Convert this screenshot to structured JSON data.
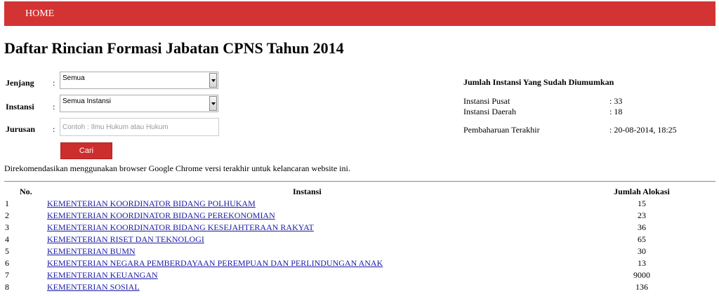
{
  "nav": {
    "home": "HOME"
  },
  "page": {
    "title": "Daftar Rincian Formasi Jabatan CPNS Tahun 2014"
  },
  "form": {
    "jenjang_label": "Jenjang",
    "jenjang_value": "Semua",
    "instansi_label": "Instansi",
    "instansi_value": "Semua Instansi",
    "jurusan_label": "Jurusan",
    "jurusan_placeholder": "Contoh : Ilmu Hukum atau Hukum",
    "colon": ":",
    "search_button": "Cari"
  },
  "recommendation": "Direkomendasikan menggunakan browser Google Chrome versi terakhir untuk kelancaran website ini.",
  "info": {
    "title": "Jumlah Instansi Yang Sudah Diumumkan",
    "pusat_label": "Instansi Pusat",
    "pusat_value": ": 33",
    "daerah_label": "Instansi Daerah",
    "daerah_value": ": 18",
    "updated_label": "Pembaharuan Terakhir",
    "updated_value": ": 20-08-2014, 18:25"
  },
  "table": {
    "headers": {
      "no": "No.",
      "instansi": "Instansi",
      "jumlah": "Jumlah Alokasi"
    },
    "rows": [
      {
        "no": "1",
        "instansi": "KEMENTERIAN KOORDINATOR BIDANG POLHUKAM",
        "jumlah": "15"
      },
      {
        "no": "2",
        "instansi": "KEMENTERIAN KOORDINATOR BIDANG PEREKONOMIAN",
        "jumlah": "23"
      },
      {
        "no": "3",
        "instansi": "KEMENTERIAN KOORDINATOR BIDANG KESEJAHTERAAN RAKYAT",
        "jumlah": "36"
      },
      {
        "no": "4",
        "instansi": "KEMENTERIAN RISET DAN TEKNOLOGI",
        "jumlah": "65"
      },
      {
        "no": "5",
        "instansi": "KEMENTERIAN BUMN",
        "jumlah": "30"
      },
      {
        "no": "6",
        "instansi": "KEMENTERIAN NEGARA PEMBERDAYAAN PEREMPUAN DAN PERLINDUNGAN ANAK",
        "jumlah": "13"
      },
      {
        "no": "7",
        "instansi": "KEMENTERIAN KEUANGAN",
        "jumlah": "9000"
      },
      {
        "no": "8",
        "instansi": "KEMENTERIAN SOSIAL",
        "jumlah": "136"
      }
    ]
  }
}
